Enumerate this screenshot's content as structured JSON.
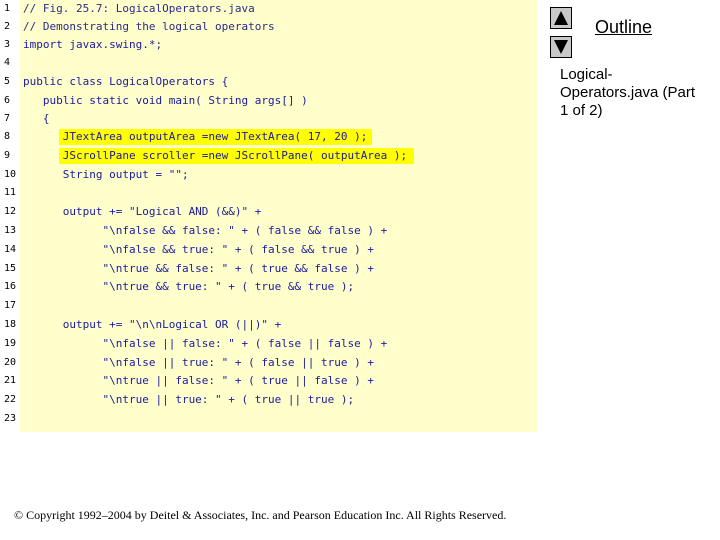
{
  "sidebar": {
    "outline_label": "Outline",
    "file_label": "Logical-\nOperators.java (Part\n1 of 2)",
    "up_button_icon": "triangle-up-icon",
    "down_button_icon": "triangle-down-icon"
  },
  "code": {
    "lines": [
      {
        "n": "1",
        "text": "// Fig. 25.7: LogicalOperators.java"
      },
      {
        "n": "2",
        "text": "// Demonstrating the logical operators"
      },
      {
        "n": "3",
        "text": "import javax.swing.*;"
      },
      {
        "n": "4",
        "text": ""
      },
      {
        "n": "5",
        "text": "public class LogicalOperators {"
      },
      {
        "n": "6",
        "text": "   public static void main( String args[] )"
      },
      {
        "n": "7",
        "text": "   {"
      },
      {
        "n": "8",
        "text": "      JTextArea outputArea =new JTextArea( 17, 20 );"
      },
      {
        "n": "9",
        "text": "      JScrollPane scroller =new JScrollPane( outputArea );"
      },
      {
        "n": "10",
        "text": "      String output = \"\";"
      },
      {
        "n": "11",
        "text": ""
      },
      {
        "n": "12",
        "text": "      output += \"Logical AND (&&)\" +"
      },
      {
        "n": "13",
        "text": "            \"\\nfalse && false: \" + ( false && false ) +"
      },
      {
        "n": "14",
        "text": "            \"\\nfalse && true: \" + ( false && true ) +"
      },
      {
        "n": "15",
        "text": "            \"\\ntrue && false: \" + ( true && false ) +"
      },
      {
        "n": "16",
        "text": "            \"\\ntrue && true: \" + ( true && true );"
      },
      {
        "n": "17",
        "text": ""
      },
      {
        "n": "18",
        "text": "      output += \"\\n\\nLogical OR (||)\" +"
      },
      {
        "n": "19",
        "text": "            \"\\nfalse || false: \" + ( false || false ) +"
      },
      {
        "n": "20",
        "text": "            \"\\nfalse || true: \" + ( false || true ) +"
      },
      {
        "n": "21",
        "text": "            \"\\ntrue || false: \" + ( true || false ) +"
      },
      {
        "n": "22",
        "text": "            \"\\ntrue || true: \" + ( true || true );"
      },
      {
        "n": "23",
        "text": ""
      }
    ]
  },
  "footer": {
    "copyright": "© Copyright 1992–2004 by Deitel & Associates, Inc. and Pearson Education Inc. All Rights Reserved."
  },
  "colors": {
    "code_background": "#ffffcc",
    "highlight": "#ffff00"
  }
}
